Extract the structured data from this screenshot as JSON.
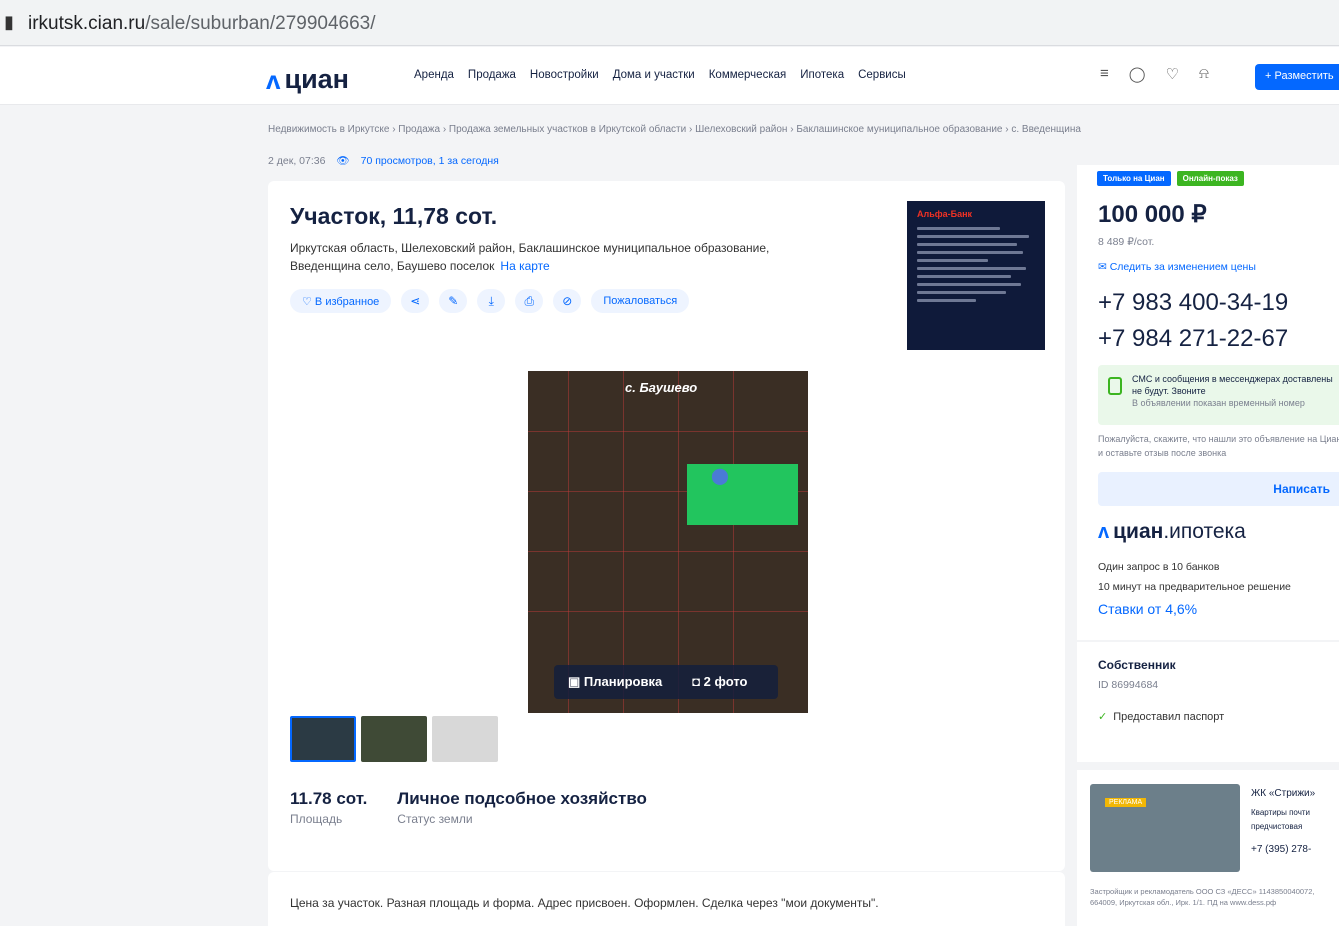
{
  "browser": {
    "url_host": "irkutsk.cian.ru",
    "url_path": "/sale/suburban/279904663/"
  },
  "header": {
    "logo": "циан",
    "nav": [
      "Аренда",
      "Продажа",
      "Новостройки",
      "Дома и участки",
      "Коммерческая",
      "Ипотека",
      "Сервисы"
    ],
    "place_button": "+ Разместить"
  },
  "breadcrumbs": "Недвижимость в Иркутске  ›  Продажа  ›  Продажа земельных участков в Иркутской области  ›  Шелеховский район  ›  Баклашинское муниципальное образование  ›  с. Введенщина",
  "meta": {
    "date": "2 дек, 07:36",
    "views": "70 просмотров, 1 за сегодня"
  },
  "listing": {
    "title": "Участок, 11,78 сот.",
    "address": "Иркутская область, Шелеховский район, Баклашинское муниципальное образование, Введенщина село, Баушево поселок",
    "on_map": "На карте",
    "favorite": "В избранное",
    "complain": "Пожаловаться",
    "ad_brand": "Альфа-Банк",
    "photo_place": "с. Баушево",
    "plan_button": "Планировка",
    "photos_button": "2 фото",
    "area_value": "11.78 сот.",
    "area_label": "Площадь",
    "status_value": "Личное подсобное хозяйство",
    "status_label": "Статус земли",
    "description": "Цена за участок. Разная площадь и форма. Адрес присвоен. Оформлен. Сделка через \"мои документы\"."
  },
  "sidebar": {
    "badge_only": "Только на Циан",
    "badge_online": "Онлайн-показ",
    "price": "100 000 ₽",
    "price_per": "8 489 ₽/сот.",
    "follow_price": "Следить за изменением цены",
    "phone1": "+7 983 400-34-19",
    "phone2": "+7 984 271-22-67",
    "sms_text": "СМС и сообщения в мессенджерах доставлены не будут. Звоните",
    "sms_sub": "В объявлении показан временный номер",
    "hint": "Пожалуйста, скажите, что нашли это объявление на Циан, и оставьте отзыв после звонка",
    "write_button": "Написать",
    "mortgage_logo": "циан",
    "mortgage_suffix": ".ипотека",
    "mortgage_line1": "Один запрос в 10 банков",
    "mortgage_line2": "10 минут на предварительное решение",
    "mortgage_rates": "Ставки от 4,6%",
    "owner_title": "Собственник",
    "owner_id": "ID 86994684",
    "owner_passport": "Предоставил паспорт",
    "promo_tag": "РЕКЛАМА",
    "promo_title": "ЖК «Стрижи»",
    "promo_line1": "Квартиры почти",
    "promo_line2": "предчистовая",
    "promo_phone": "+7 (395) 278-",
    "promo_small": "Застройщик и рекламодатель ООО СЗ «ДЕСС» 1143850040072, 664009, Иркутская обл., Ирк. 1/1. ПД на www.dess.рф"
  },
  "colors": {
    "brand": "#0468ff",
    "online": "#3cb521",
    "map_highlight": "#22c55e"
  }
}
